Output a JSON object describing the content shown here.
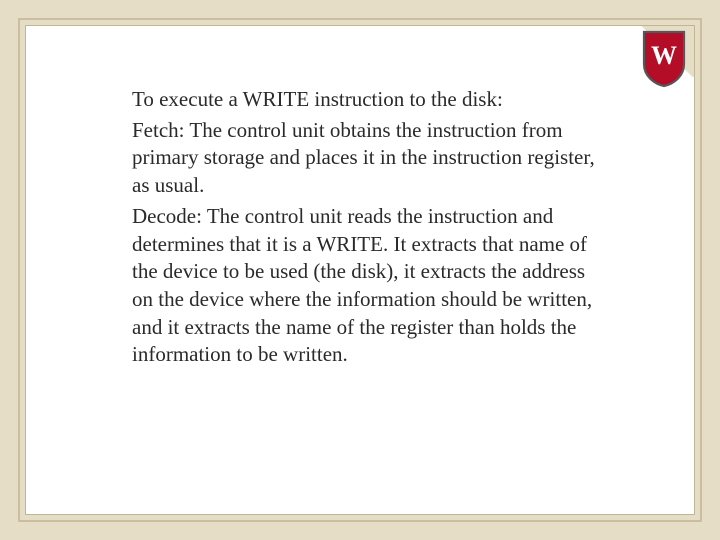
{
  "crest": {
    "letter": "W",
    "bg_fill": "#b40d27",
    "border": "#575757",
    "text_fill": "#ffffff"
  },
  "body": {
    "p1": "To execute a WRITE instruction to the disk:",
    "p2": "Fetch: The control unit obtains the instruction from primary storage and places it in the instruction register, as usual.",
    "p3": "Decode: The control unit reads the instruction and determines that it is a WRITE. It extracts that name of the device to be used (the disk), it extracts the address on the device where the information should be written, and it extracts the name of the register than holds the information to be written."
  }
}
